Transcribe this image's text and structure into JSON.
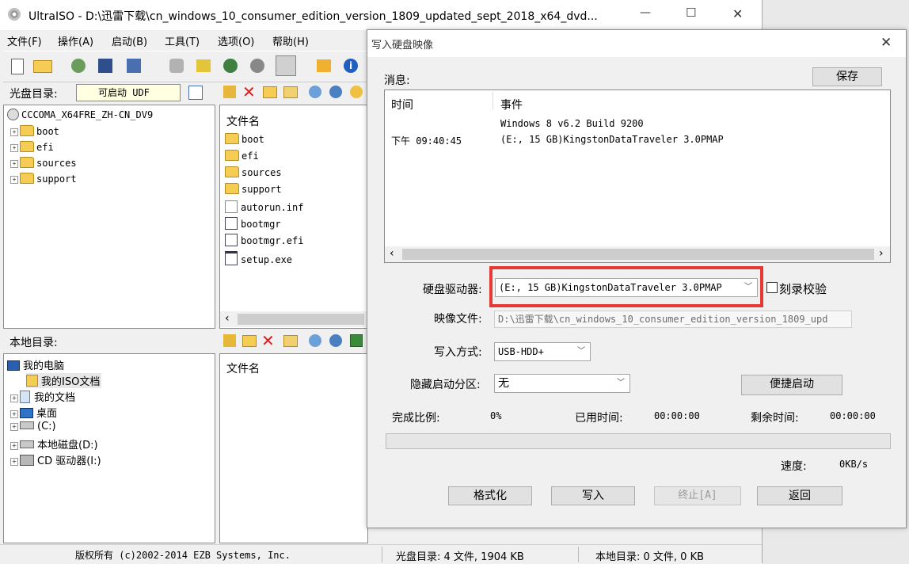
{
  "app": {
    "title": "UltraISO - D:\\迅雷下载\\cn_windows_10_consumer_edition_version_1809_updated_sept_2018_x64_dvd...",
    "minimize": "—",
    "maximize": "☐",
    "close": "✕"
  },
  "menu": [
    "文件(F)",
    "操作(A)",
    "启动(B)",
    "工具(T)",
    "选项(O)",
    "帮助(H)"
  ],
  "cd_pane": {
    "label": "光盘目录:",
    "boot_label": "可启动 UDF",
    "root": "CCCOMA_X64FRE_ZH-CN_DV9",
    "folders": [
      "boot",
      "efi",
      "sources",
      "support"
    ]
  },
  "cd_files": {
    "header": "文件名",
    "items": [
      "boot",
      "efi",
      "sources",
      "support",
      "autorun.inf",
      "bootmgr",
      "bootmgr.efi",
      "setup.exe"
    ]
  },
  "local_pane": {
    "label": "本地目录:",
    "items": [
      "我的电脑",
      "我的ISO文档",
      "我的文档",
      "桌面",
      "(C:)",
      "本地磁盘(D:)",
      "CD 驱动器(I:)"
    ]
  },
  "local_files": {
    "header": "文件名"
  },
  "statusbar": {
    "copyright": "版权所有 (c)2002-2014 EZB Systems, Inc.",
    "cd_info": "光盘目录: 4 文件, 1904 KB",
    "local_info": "本地目录: 0 文件, 0 KB"
  },
  "dialog": {
    "title": "写入硬盘映像",
    "close": "✕",
    "messages_label": "消息:",
    "save_button": "保存",
    "log": {
      "col_time": "时间",
      "col_event": "事件",
      "rows": [
        {
          "time": "",
          "event": "Windows 8 v6.2 Build 9200"
        },
        {
          "time": "下午 09:40:45",
          "event": "(E:, 15 GB)KingstonDataTraveler 3.0PMAP"
        }
      ]
    },
    "disk_drive_label": "硬盘驱动器:",
    "disk_drive_value": "(E:, 15 GB)KingstonDataTraveler 3.0PMAP",
    "verify_label": "刻录校验",
    "image_file_label": "映像文件:",
    "image_file_value": "D:\\迅雷下载\\cn_windows_10_consumer_edition_version_1809_upd",
    "write_mode_label": "写入方式:",
    "write_mode_value": "USB-HDD+",
    "hide_partition_label": "隐藏启动分区:",
    "hide_partition_value": "无",
    "quick_boot_button": "便捷启动",
    "percent_label": "完成比例:",
    "percent_value": "0%",
    "elapsed_label": "已用时间:",
    "elapsed_value": "00:00:00",
    "remaining_label": "剩余时间:",
    "remaining_value": "00:00:00",
    "speed_label": "速度:",
    "speed_value": "0KB/s",
    "progress": 0,
    "format_button": "格式化",
    "write_button": "写入",
    "abort_button": "终止[A]",
    "back_button": "返回",
    "highlight_color": "#e53935"
  }
}
